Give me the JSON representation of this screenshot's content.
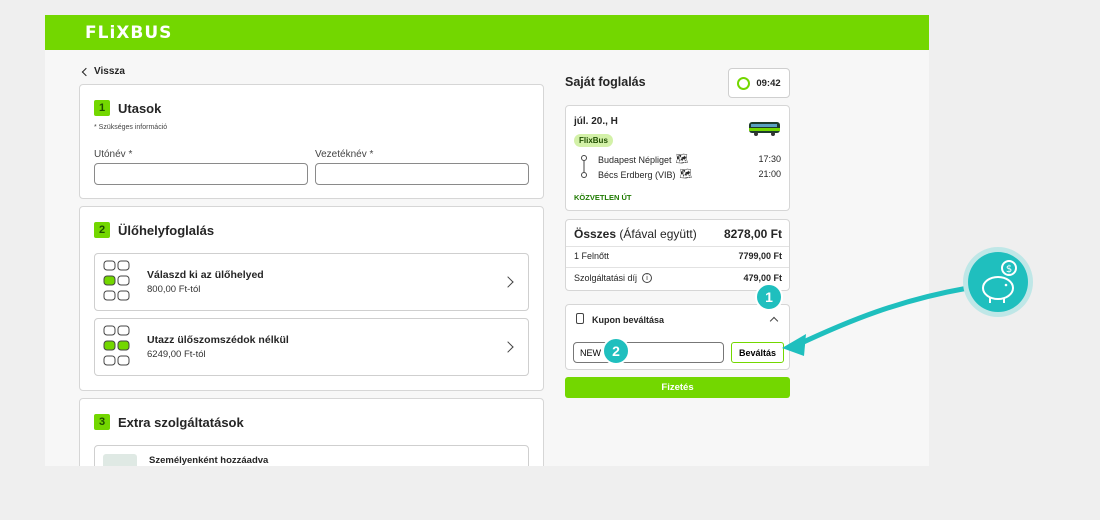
{
  "brand": {
    "logo": "FLiXBUS",
    "color": "#73d700"
  },
  "nav": {
    "back_label": "Vissza"
  },
  "passengers": {
    "step": "1",
    "title": "Utasok",
    "required_note": "* Szükséges információ",
    "first_name_label": "Utónév *",
    "last_name_label": "Vezetéknév *",
    "first_name_value": "",
    "last_name_value": ""
  },
  "seats": {
    "step": "2",
    "title": "Ülőhelyfoglalás",
    "options": [
      {
        "title": "Válaszd ki az ülőhelyed",
        "price": "800,00 Ft-tól"
      },
      {
        "title": "Utazz ülőszomszédok nélkül",
        "price": "6249,00 Ft-tól"
      }
    ]
  },
  "extras": {
    "step": "3",
    "title": "Extra szolgáltatások",
    "first_item": "Személyenként hozzáadva"
  },
  "booking": {
    "title": "Saját foglalás",
    "timer": "09:42",
    "date": "júl. 20., H",
    "operator_badge": "FlixBus",
    "from_stop": "Budapest Népliget",
    "from_time": "17:30",
    "to_stop": "Bécs Erdberg (VIB)",
    "to_time": "21:00",
    "direct_label": "KÖZVETLEN ÚT"
  },
  "summary": {
    "total_label": "Összes",
    "total_vat": "(Áfával együtt)",
    "total_value": "8278,00 Ft",
    "adult_label": "1 Felnőtt",
    "adult_value": "7799,00 Ft",
    "service_label": "Szolgáltatási díj",
    "service_value": "479,00 Ft"
  },
  "coupon": {
    "title": "Kupon beváltása",
    "value": "NEW",
    "button": "Beváltás"
  },
  "payment": {
    "button": "Fizetés"
  },
  "annotations": {
    "step1": "1",
    "step2": "2",
    "accent": "#1fbfbe"
  }
}
